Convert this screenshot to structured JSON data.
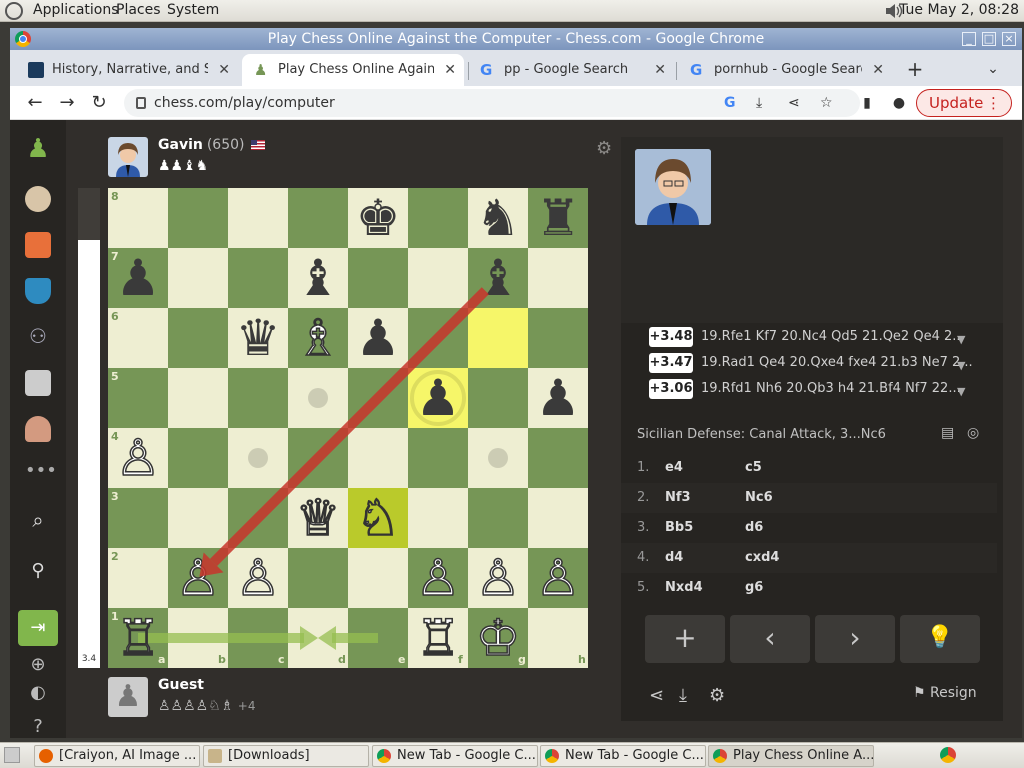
{
  "system": {
    "menus": [
      "Applications",
      "Places",
      "System"
    ],
    "clock": "Tue May  2, 08:28"
  },
  "window": {
    "title": "Play Chess Online Against the Computer - Chess.com - Google Chrome"
  },
  "tabs": [
    {
      "label": "History, Narrative, and Sex",
      "icon": "chess-favicon-icon"
    },
    {
      "label": "Play Chess Online Against the Computer",
      "icon": "pawn-favicon-icon",
      "active": true
    },
    {
      "label": "pp - Google Search",
      "icon": "google-icon"
    },
    {
      "label": "pornhub - Google Search",
      "icon": "google-icon"
    }
  ],
  "toolbar": {
    "url": "chess.com/play/computer",
    "update_label": "Update"
  },
  "game": {
    "opponent": {
      "name": "Gavin",
      "rating": "(650)",
      "captured": "♟♟♝♞"
    },
    "player": {
      "name": "Guest",
      "captured": "♙♙♙♙♘♗",
      "advantage": "+4"
    },
    "eval_value": "3.4",
    "files": [
      "a",
      "b",
      "c",
      "d",
      "e",
      "f",
      "g",
      "h"
    ],
    "ranks": [
      "8",
      "7",
      "6",
      "5",
      "4",
      "3",
      "2",
      "1"
    ],
    "pieces": [
      {
        "sq": "e8",
        "p": "♚",
        "c": "b"
      },
      {
        "sq": "g8",
        "p": "♞",
        "c": "b"
      },
      {
        "sq": "h8",
        "p": "♜",
        "c": "b"
      },
      {
        "sq": "a7",
        "p": "♟",
        "c": "b"
      },
      {
        "sq": "d7",
        "p": "♝",
        "c": "b"
      },
      {
        "sq": "g7",
        "p": "♝",
        "c": "b"
      },
      {
        "sq": "c6",
        "p": "♛",
        "c": "b"
      },
      {
        "sq": "d6",
        "p": "♗",
        "c": "w"
      },
      {
        "sq": "e6",
        "p": "♟",
        "c": "b"
      },
      {
        "sq": "f5",
        "p": "♟",
        "c": "b"
      },
      {
        "sq": "h5",
        "p": "♟",
        "c": "b"
      },
      {
        "sq": "a4",
        "p": "♙",
        "c": "w"
      },
      {
        "sq": "d3",
        "p": "♕",
        "c": "w"
      },
      {
        "sq": "e3",
        "p": "♘",
        "c": "w"
      },
      {
        "sq": "b2",
        "p": "♙",
        "c": "w"
      },
      {
        "sq": "c2",
        "p": "♙",
        "c": "w"
      },
      {
        "sq": "f2",
        "p": "♙",
        "c": "w"
      },
      {
        "sq": "g2",
        "p": "♙",
        "c": "w"
      },
      {
        "sq": "h2",
        "p": "♙",
        "c": "w"
      },
      {
        "sq": "a1",
        "p": "♖",
        "c": "w"
      },
      {
        "sq": "f1",
        "p": "♖",
        "c": "w"
      },
      {
        "sq": "g1",
        "p": "♔",
        "c": "w"
      }
    ],
    "highlights": [
      "g6",
      "f5",
      "e3"
    ],
    "hints": [
      "d5",
      "c4",
      "g4"
    ],
    "arrow": {
      "from": "g7",
      "to": "b2",
      "color": "#c8352b"
    },
    "castle_arrows": [
      {
        "from": "a1",
        "to": "d1"
      },
      {
        "from": "e1",
        "to": "d1"
      }
    ]
  },
  "analysis": {
    "lines": [
      {
        "score": "+3.48",
        "text": "19.Rfe1 Kf7 20.Nc4 Qd5 21.Qe2 Qe4 2..."
      },
      {
        "score": "+3.47",
        "text": "19.Rad1 Qe4 20.Qxe4 fxe4 21.b3 Ne7 2..."
      },
      {
        "score": "+3.06",
        "text": "19.Rfd1 Nh6 20.Qb3 h4 21.Bf4 Nf7 22...."
      }
    ],
    "opening": "Sicilian Defense: Canal Attack, 3...Nc6",
    "moves": [
      {
        "n": "1.",
        "w": "e4",
        "b": "c5"
      },
      {
        "n": "2.",
        "w": "Nf3",
        "b": "Nc6"
      },
      {
        "n": "3.",
        "w": "Bb5",
        "b": "d6"
      },
      {
        "n": "4.",
        "w": "d4",
        "b": "cxd4"
      },
      {
        "n": "5.",
        "w": "Nxd4",
        "b": "g6"
      }
    ],
    "resign_label": "Resign"
  },
  "taskbar": [
    {
      "label": "[Craiyon, AI Image ...",
      "icon": "firefox-icon"
    },
    {
      "label": "[Downloads]",
      "icon": "folder-icon"
    },
    {
      "label": "New Tab - Google C...",
      "icon": "chrome-icon"
    },
    {
      "label": "New Tab - Google C...",
      "icon": "chrome-icon"
    },
    {
      "label": "Play Chess Online A...",
      "icon": "chrome-icon"
    }
  ]
}
